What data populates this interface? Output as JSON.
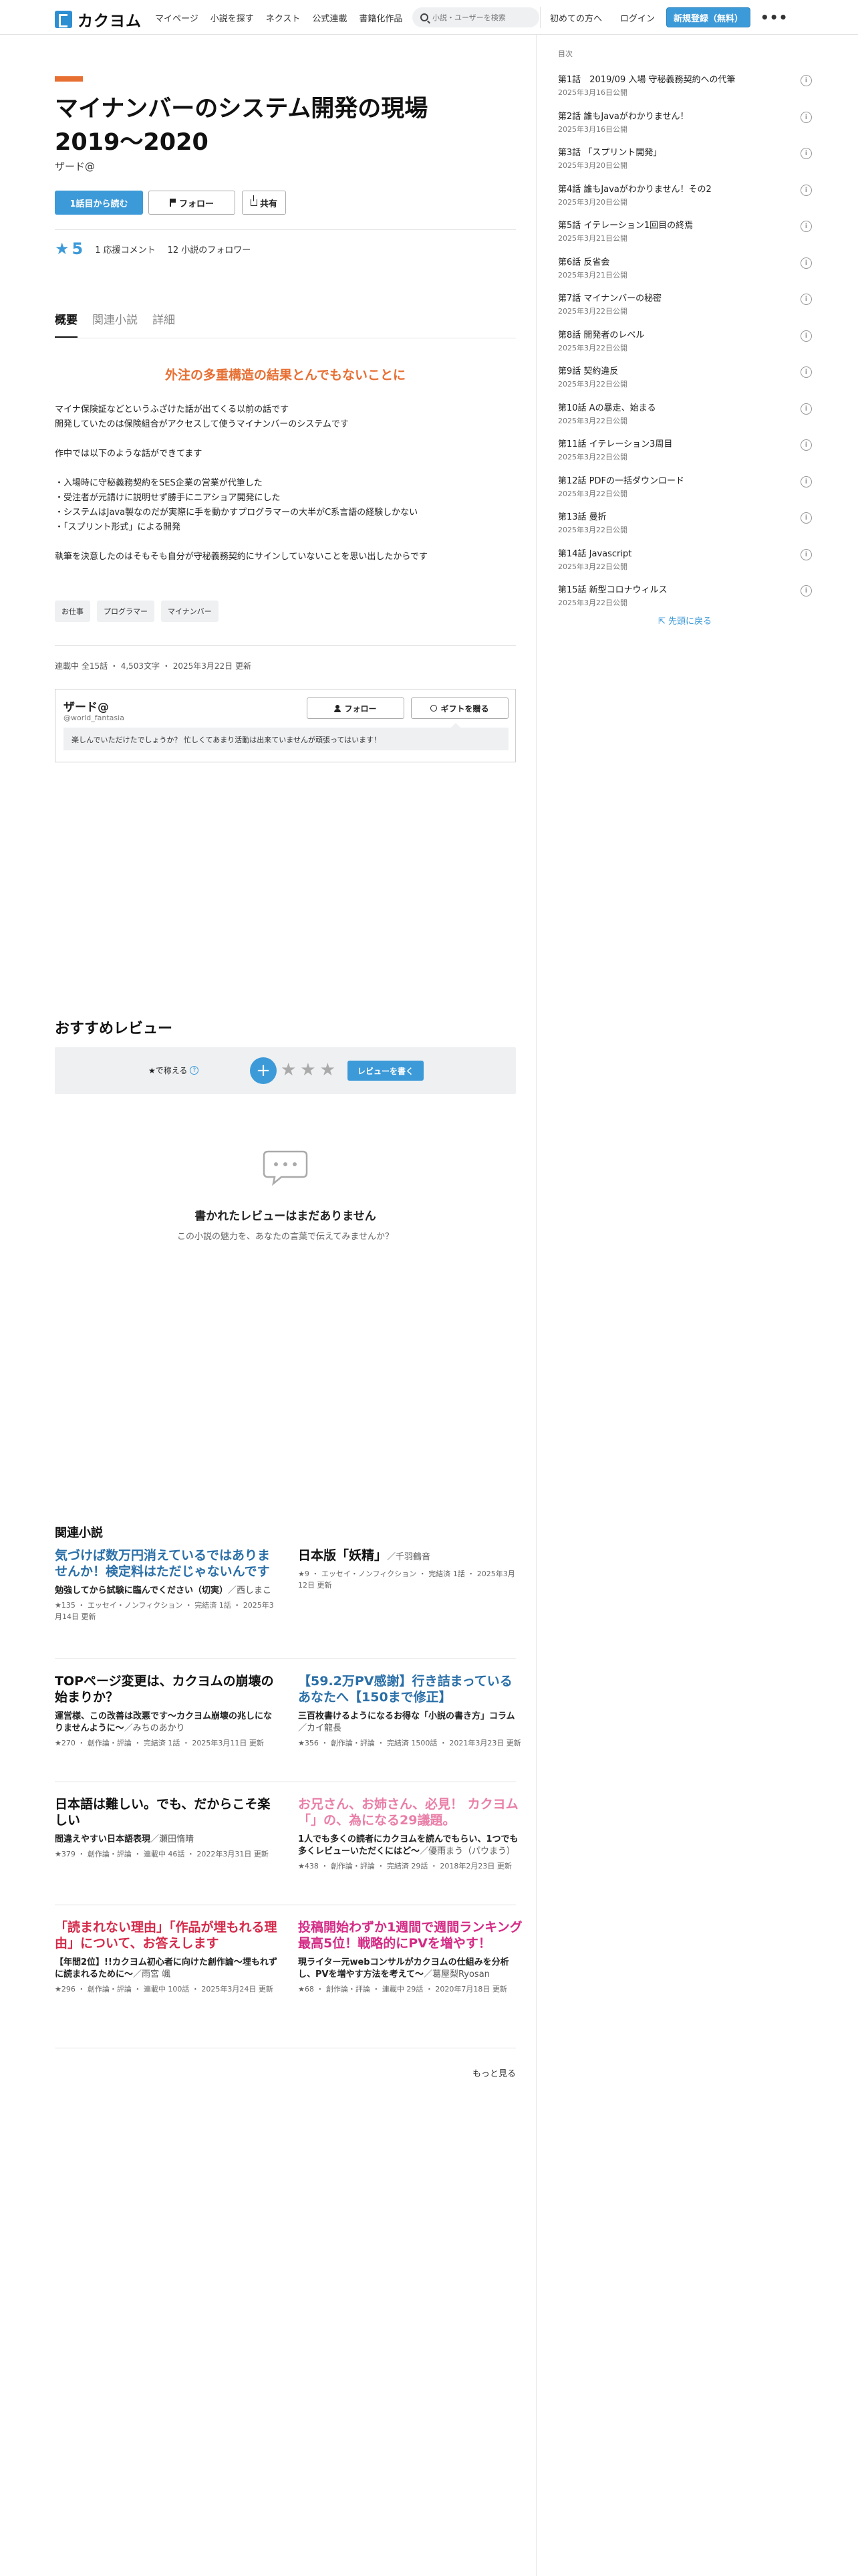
{
  "header": {
    "logo_text": "カクヨム",
    "nav": [
      "マイページ",
      "小説を探す",
      "ネクスト",
      "公式連載",
      "書籍化作品"
    ],
    "search_placeholder": "小説・ユーザーを検索",
    "first_time": "初めての方へ",
    "login": "ログイン",
    "signup": "新規登録（無料）",
    "more": "•••"
  },
  "work": {
    "title": "マイナンバーのシステム開発の現場2019〜2020",
    "author": "ザード@",
    "read_first": "1話目から読む",
    "follow": "フォロー",
    "share": "共有",
    "star_symbol": "★",
    "stars": "5",
    "comments": "1 応援コメント",
    "followers": "12 小説のフォロワー"
  },
  "tabs": [
    "概要",
    "関連小説",
    "詳細"
  ],
  "summary": {
    "catch": "外注の多重構造の結果とんでもないことに",
    "lines": [
      "マイナ保険証などというふざけた話が出てくる以前の話です",
      "開発していたのは保険組合がアクセスして使うマイナンバーのシステムです",
      "",
      "作中では以下のような話ができてます",
      "",
      "・入場時に守秘義務契約をSES企業の営業が代筆した",
      "・受注者が元請けに説明せず勝手にニアショア開発にした",
      "・システムはJava製なのだが実際に手を動かすプログラマーの大半がC系言語の経験しかない",
      "・「スプリント形式」による開発",
      "",
      "執筆を決意したのはそもそも自分が守秘義務契約にサインしていないことを思い出したからです"
    ],
    "tags": [
      "お仕事",
      "プログラマー",
      "マイナンバー"
    ],
    "meta": "連載中 全15話 ・ 4,503文字 ・ 2025年3月22日 更新"
  },
  "author_card": {
    "name": "ザード@",
    "id": "@world_fantasia",
    "follow": "フォロー",
    "gift": "ギフトを贈る",
    "message": "楽しんでいただけたでしょうか？ 忙しくてあまり活動は出来ていませんが頑張ってはいます！"
  },
  "reviews": {
    "title": "おすすめレビュー",
    "rate_label": "★で称える",
    "help": "?",
    "plus": "+",
    "gray_stars": "★★★",
    "write": "レビューを書く",
    "empty_title": "書かれたレビューはまだありません",
    "empty_sub": "この小説の魅力を、あなたの言葉で伝えてみませんか？"
  },
  "related": {
    "title": "関連小説",
    "items": [
      {
        "title": "気づけば数万円消えているではありませんか！検定料はただじゃないんです",
        "color": "#2a6fa8",
        "catch": "勉強してから試験に臨んでください（切実）",
        "author": "／西しまこ",
        "meta": "★135 ・ エッセイ・ノンフィクション ・ 完結済 1話 ・ 2025年3月14日 更新"
      },
      {
        "title": "日本版「妖精」",
        "color": "#111111",
        "catch": "",
        "author": "／千羽鶴音",
        "meta": "★9 ・ エッセイ・ノンフィクション ・ 完結済 1話 ・ 2025年3月12日 更新"
      },
      {
        "title": "TOPページ変更は、カクヨムの崩壊の始まりか？",
        "color": "#111111",
        "catch": "運営様、この改善は改悪です〜カクヨム崩壊の兆しになりませんように〜",
        "author": "／みちのあかり",
        "meta": "★270 ・ 創作論・評論 ・ 完結済 1話 ・ 2025年3月11日 更新"
      },
      {
        "title": "【59.2万PV感謝】行き詰まっているあなたへ【150まで修正】",
        "color": "#2a6fa8",
        "catch": "三百枚書けるようになるお得な「小説の書き方」コラム",
        "author": "／カイ龍長",
        "meta": "★356 ・ 創作論・評論 ・ 完結済 1500話 ・ 2021年3月23日 更新"
      },
      {
        "title": "日本語は難しい。でも、だからこそ楽しい",
        "color": "#111111",
        "catch": "間違えやすい日本語表現",
        "author": "／瀬田惰晴",
        "meta": "★379 ・ 創作論・評論 ・ 連載中 46話 ・ 2022年3月31日 更新"
      },
      {
        "title": "お兄さん、お姉さん、必見！ カクヨム「」の、為になる29議題。",
        "color": "#e97fa8",
        "catch": "1人でも多くの読者にカクヨムを読んでもらい、1つでも多くレビューいただくにはど〜",
        "author": "／優雨まう（パウまう）",
        "meta": "★438 ・ 創作論・評論 ・ 完結済 29話 ・ 2018年2月23日 更新"
      },
      {
        "title": "「読まれない理由」「作品が埋もれる理由」について、お答えします",
        "color": "#d42a4a",
        "catch": "【年間2位】!!カクヨム初心者に向けた創作論〜埋もれずに読まれるために〜",
        "author": "／雨宮 颯",
        "meta": "★296 ・ 創作論・評論 ・ 連載中 100話 ・ 2025年3月24日 更新"
      },
      {
        "title": "投稿開始わずか1週間で週間ランキング最高5位！戦略的にPVを増やす！",
        "color": "#d42a85",
        "catch": "現ライター元webコンサルがカクヨムの仕組みを分析し、PVを増やす方法を考えて〜",
        "author": "／葛屋梨Ryosan",
        "meta": "★68 ・ 創作論・評論 ・ 連載中 29話 ・ 2020年7月18日 更新"
      }
    ],
    "more": "もっと見る"
  },
  "toc": {
    "label": "目次",
    "info_symbol": "i",
    "episodes": [
      {
        "title": "第1話　2019/09 入場 守秘義務契約への代筆",
        "date": "2025年3月16日公開"
      },
      {
        "title": "第2話 誰もJavaがわかりません！",
        "date": "2025年3月16日公開"
      },
      {
        "title": "第3話 「スプリント開発」",
        "date": "2025年3月20日公開"
      },
      {
        "title": "第4話 誰もJavaがわかりません！その2",
        "date": "2025年3月20日公開"
      },
      {
        "title": "第5話 イテレーション1回目の終焉",
        "date": "2025年3月21日公開"
      },
      {
        "title": "第6話 反省会",
        "date": "2025年3月21日公開"
      },
      {
        "title": "第7話 マイナンバーの秘密",
        "date": "2025年3月22日公開"
      },
      {
        "title": "第8話 開発者のレベル",
        "date": "2025年3月22日公開"
      },
      {
        "title": "第9話 契約違反",
        "date": "2025年3月22日公開"
      },
      {
        "title": "第10話 Aの暴走、始まる",
        "date": "2025年3月22日公開"
      },
      {
        "title": "第11話 イテレーション3周目",
        "date": "2025年3月22日公開"
      },
      {
        "title": "第12話 PDFの一括ダウンロード",
        "date": "2025年3月22日公開"
      },
      {
        "title": "第13話 曼折",
        "date": "2025年3月22日公開"
      },
      {
        "title": "第14話 Javascript",
        "date": "2025年3月22日公開"
      },
      {
        "title": "第15話 新型コロナウィルス",
        "date": "2025年3月22日公開"
      }
    ],
    "back_top": "先頭に戻る"
  }
}
